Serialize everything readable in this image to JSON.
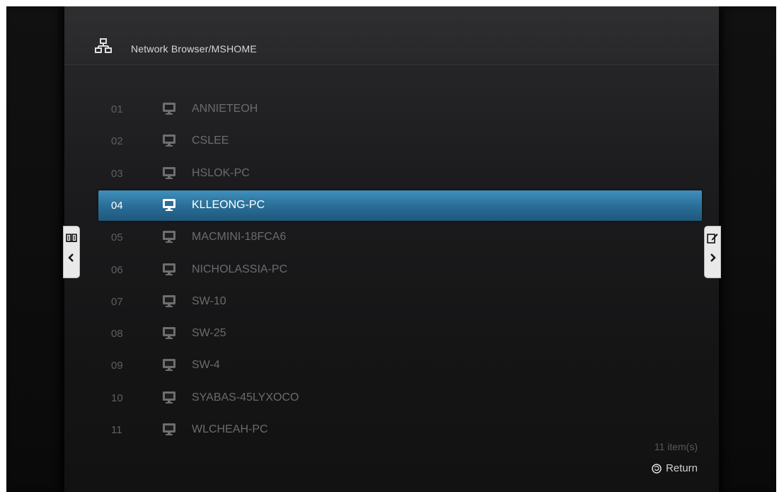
{
  "header": {
    "title": "Network Browser/MSHOME",
    "icon": "network-icon"
  },
  "list": {
    "selected_index": 3,
    "items": [
      {
        "num": "01",
        "name": "ANNIETEOH"
      },
      {
        "num": "02",
        "name": "CSLEE"
      },
      {
        "num": "03",
        "name": "HSLOK-PC"
      },
      {
        "num": "04",
        "name": "KLLEONG-PC"
      },
      {
        "num": "05",
        "name": "MACMINI-18FCA6"
      },
      {
        "num": "06",
        "name": "NICHOLASSIA-PC"
      },
      {
        "num": "07",
        "name": "SW-10"
      },
      {
        "num": "08",
        "name": "SW-25"
      },
      {
        "num": "09",
        "name": "SW-4"
      },
      {
        "num": "10",
        "name": "SYABAS-45LYXOCO"
      },
      {
        "num": "11",
        "name": "WLCHEAH-PC"
      }
    ]
  },
  "footer": {
    "count": "11 item(s)",
    "return_label": "Return"
  },
  "colors": {
    "selection": "#2a6f98",
    "accent": "#3f90bd"
  }
}
